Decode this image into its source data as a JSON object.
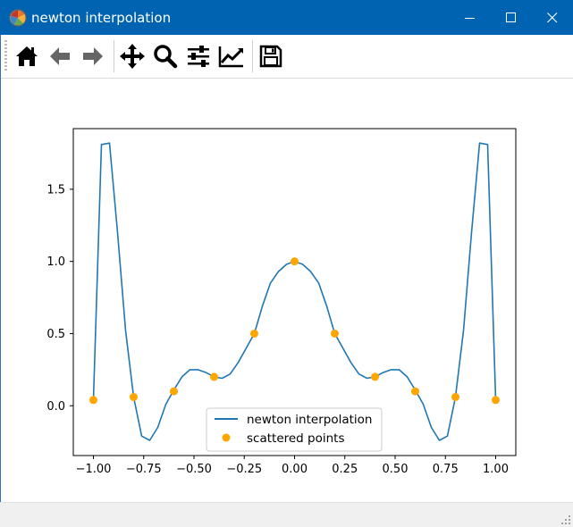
{
  "window": {
    "title": "newton interpolation",
    "buttons": {
      "minimize": "minimize-icon",
      "maximize": "maximize-icon",
      "close": "close-icon"
    }
  },
  "toolbar": {
    "buttons": [
      {
        "name": "home",
        "icon": "home-icon"
      },
      {
        "name": "back",
        "icon": "arrow-left-icon"
      },
      {
        "name": "forward",
        "icon": "arrow-right-icon"
      },
      {
        "name": "pan",
        "icon": "move-icon"
      },
      {
        "name": "zoom",
        "icon": "magnifier-icon"
      },
      {
        "name": "subplots",
        "icon": "sliders-icon"
      },
      {
        "name": "edit-axis",
        "icon": "chart-line-icon"
      },
      {
        "name": "save",
        "icon": "floppy-disk-icon"
      }
    ]
  },
  "colors": {
    "titlebar": "#0063b1",
    "line": "#1f77b4",
    "points": "#ffa500"
  },
  "chart_data": {
    "type": "line",
    "title": "",
    "xlabel": "",
    "ylabel": "",
    "xlim": [
      -1.1,
      1.1
    ],
    "ylim": [
      -0.345,
      1.92
    ],
    "xticks": [
      -1.0,
      -0.75,
      -0.5,
      -0.25,
      0.0,
      0.25,
      0.5,
      0.75,
      1.0
    ],
    "xtick_labels": [
      "−1.00",
      "−0.75",
      "−0.50",
      "−0.25",
      "0.00",
      "0.25",
      "0.50",
      "0.75",
      "1.00"
    ],
    "yticks": [
      0.0,
      0.5,
      1.0,
      1.5
    ],
    "ytick_labels": [
      "0.0",
      "0.5",
      "1.0",
      "1.5"
    ],
    "grid": false,
    "legend": {
      "position": "lower-center",
      "entries": [
        "newton interpolation",
        "scattered points"
      ]
    },
    "series": [
      {
        "name": "newton interpolation",
        "kind": "line",
        "x": [
          -1.0,
          -0.96,
          -0.92,
          -0.88,
          -0.84,
          -0.8,
          -0.76,
          -0.72,
          -0.68,
          -0.64,
          -0.6,
          -0.56,
          -0.52,
          -0.48,
          -0.44,
          -0.4,
          -0.36,
          -0.32,
          -0.28,
          -0.24,
          -0.2,
          -0.16,
          -0.12,
          -0.08,
          -0.04,
          0.0,
          0.04,
          0.08,
          0.12,
          0.16,
          0.2,
          0.24,
          0.28,
          0.32,
          0.36,
          0.4,
          0.44,
          0.48,
          0.52,
          0.56,
          0.6,
          0.64,
          0.68,
          0.72,
          0.76,
          0.8,
          0.84,
          0.88,
          0.92,
          0.96,
          1.0
        ],
        "y": [
          0.04,
          1.81,
          1.82,
          1.2,
          0.52,
          0.06,
          -0.21,
          -0.24,
          -0.15,
          0.01,
          0.11,
          0.2,
          0.25,
          0.25,
          0.23,
          0.2,
          0.19,
          0.22,
          0.3,
          0.4,
          0.5,
          0.69,
          0.85,
          0.93,
          0.98,
          1.0,
          0.98,
          0.93,
          0.85,
          0.69,
          0.5,
          0.4,
          0.3,
          0.22,
          0.19,
          0.2,
          0.23,
          0.25,
          0.25,
          0.2,
          0.11,
          0.01,
          -0.15,
          -0.24,
          -0.21,
          0.06,
          0.52,
          1.2,
          1.82,
          1.81,
          0.04
        ]
      },
      {
        "name": "scattered points",
        "kind": "scatter",
        "x": [
          -1.0,
          -0.8,
          -0.6,
          -0.4,
          -0.2,
          0.0,
          0.2,
          0.4,
          0.6,
          0.8,
          1.0
        ],
        "y": [
          0.04,
          0.06,
          0.1,
          0.2,
          0.5,
          1.0,
          0.5,
          0.2,
          0.1,
          0.06,
          0.04
        ]
      }
    ]
  }
}
